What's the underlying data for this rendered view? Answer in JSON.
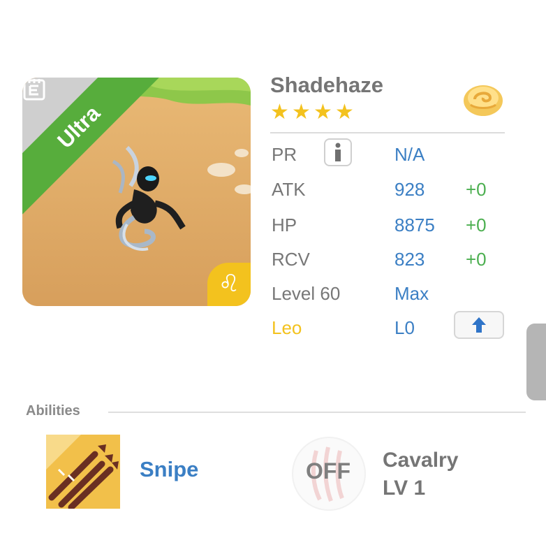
{
  "monster": {
    "rarity": "Ultra",
    "name": "Shadehaze",
    "stars": 4,
    "zodiac_symbol": "♌",
    "icons": {
      "document": "document-icon",
      "zodiac": "leo-zodiac-icon",
      "element": "cloud-orb-icon",
      "info": "info-icon",
      "upgrade": "arrow-up-icon"
    }
  },
  "stats": {
    "pr": {
      "label": "PR",
      "value": "N/A"
    },
    "atk": {
      "label": "ATK",
      "value": "928",
      "bonus": "+0"
    },
    "hp": {
      "label": "HP",
      "value": "8875",
      "bonus": "+0"
    },
    "rcv": {
      "label": "RCV",
      "value": "823",
      "bonus": "+0"
    },
    "level": {
      "label": "Level 60",
      "value": "Max"
    },
    "zodiac": {
      "label": "Leo",
      "value": "L0"
    }
  },
  "abilities": {
    "title": "Abilities",
    "active": {
      "name": "Snipe"
    },
    "passive": {
      "toggle": "OFF",
      "name": "Cavalry",
      "level": "LV 1"
    }
  },
  "colors": {
    "ultra_green": "#57ad3c",
    "value_blue": "#3b7fc4",
    "bonus_green": "#4caf50",
    "leo_yellow": "#f3c21e",
    "label_gray": "#777777"
  }
}
